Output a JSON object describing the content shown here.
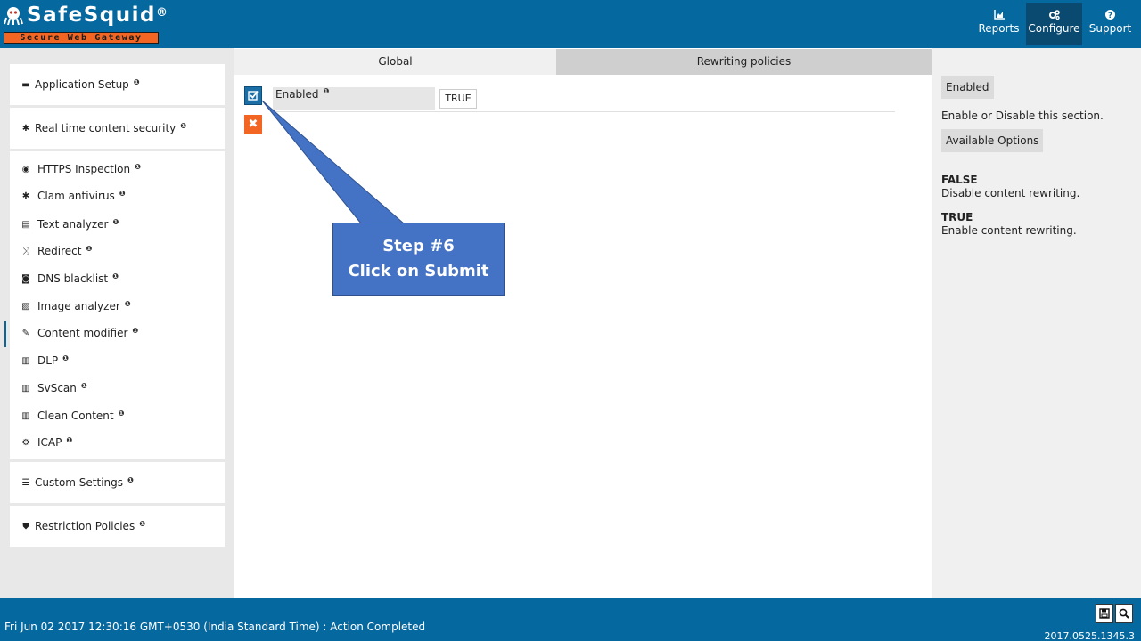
{
  "header": {
    "logo_text": "SafeSquid",
    "logo_reg": "®",
    "logo_tagline": "Secure Web Gateway",
    "nav": [
      {
        "label": "Reports",
        "icon": "chart-icon"
      },
      {
        "label": "Configure",
        "icon": "cogs-icon"
      },
      {
        "label": "Support",
        "icon": "question-icon"
      }
    ]
  },
  "sidebar": {
    "groups": [
      {
        "label": "Application Setup",
        "icon": "briefcase-icon"
      },
      {
        "label": "Real time content security",
        "icon": "bug-icon"
      },
      {
        "label": "Custom Settings",
        "icon": "sliders-icon"
      },
      {
        "label": "Restriction Policies",
        "icon": "shield-icon"
      }
    ],
    "items": [
      {
        "label": "HTTPS Inspection",
        "icon": "eye-icon"
      },
      {
        "label": "Clam antivirus",
        "icon": "asterisk-icon"
      },
      {
        "label": "Text analyzer",
        "icon": "word-file-icon"
      },
      {
        "label": "Redirect",
        "icon": "random-icon"
      },
      {
        "label": "DNS blacklist",
        "icon": "dns-icon"
      },
      {
        "label": "Image analyzer",
        "icon": "image-file-icon"
      },
      {
        "label": "Content modifier",
        "icon": "edit-icon"
      },
      {
        "label": "DLP",
        "icon": "barcode-icon"
      },
      {
        "label": "SvScan",
        "icon": "barcode-icon"
      },
      {
        "label": "Clean Content",
        "icon": "barcode-icon"
      },
      {
        "label": "ICAP",
        "icon": "cog-icon"
      }
    ],
    "info_mark": "❶"
  },
  "main": {
    "tabs": [
      {
        "label": "Global"
      },
      {
        "label": "Rewriting policies"
      }
    ],
    "field": {
      "label": "Enabled",
      "value": "TRUE"
    },
    "callout": {
      "line1": "Step #6",
      "line2": "Click on Submit"
    }
  },
  "right_panel": {
    "title": "Enabled",
    "description": "Enable or Disable this section.",
    "options_title": "Available Options",
    "options": [
      {
        "name": "FALSE",
        "desc": "Disable content rewriting."
      },
      {
        "name": "TRUE",
        "desc": "Enable content rewriting."
      }
    ]
  },
  "footer": {
    "status": "Fri Jun 02 2017 12:30:16 GMT+0530 (India Standard Time) : Action Completed",
    "version": "2017.0525.1345.3"
  },
  "colors": {
    "brand_blue": "#05689f",
    "accent_orange": "#f26522",
    "callout_blue": "#4472c4"
  }
}
